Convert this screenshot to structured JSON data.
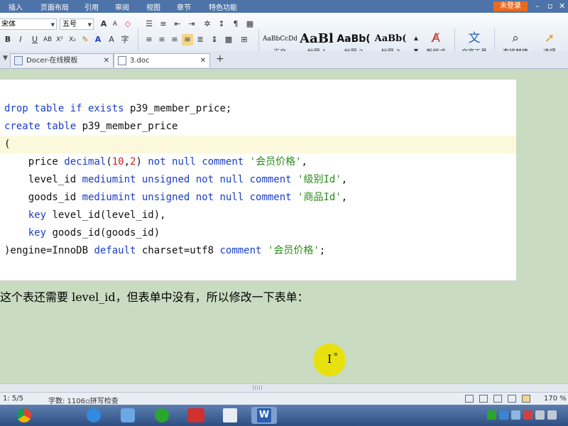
{
  "menubar": {
    "items": [
      "插入",
      "页面布局",
      "引用",
      "审阅",
      "视图",
      "章节",
      "特色功能"
    ],
    "login": "未登录"
  },
  "ribbon": {
    "font_name": "宋体",
    "font_size": "五号",
    "styles": [
      {
        "sample": "AaBbCcDd",
        "name": "正文"
      },
      {
        "sample": "AaBl",
        "name": "标题 1"
      },
      {
        "sample": "AaBb(",
        "name": "标题 2"
      },
      {
        "sample": "AaBb(",
        "name": "标题 3"
      }
    ],
    "new_style": "新样式",
    "text_tools": "文字工具",
    "find_replace": "查找替换",
    "select": "选择"
  },
  "tabs": [
    {
      "label": "Docer-在线模板"
    },
    {
      "label": "3.doc"
    }
  ],
  "code": {
    "line1": {
      "kw1": "drop table if exists",
      "rest": " p39_member_price;"
    },
    "line2": {
      "kw1": "create table",
      "rest": " p39_member_price"
    },
    "line3": "(",
    "line4": {
      "pre": "    price ",
      "kw1": "decimal",
      "p1": "(",
      "n1": "10",
      "p2": ",",
      "n2": "2",
      "p3": ") ",
      "kw2": "not null comment",
      "sp": " ",
      "str": "'会员价格'",
      "end": ","
    },
    "line5": {
      "pre": "    level_id ",
      "kw1": "mediumint unsigned not null comment",
      "sp": " ",
      "str": "'级别Id'",
      "end": ","
    },
    "line6": {
      "pre": "    goods_id ",
      "kw1": "mediumint unsigned not null comment",
      "sp": " ",
      "str": "'商品Id'",
      "end": ","
    },
    "line7": {
      "pre": "    ",
      "kw1": "key",
      "rest": " level_id(level_id),"
    },
    "line8": {
      "pre": "    ",
      "kw1": "key",
      "rest": " goods_id(goods_id)"
    },
    "line9": {
      "pre": ")engine=InnoDB ",
      "kw1": "default",
      "mid": " charset=utf8 ",
      "kw2": "comment",
      "sp": " ",
      "str": "'会员价格'",
      "end": ";"
    }
  },
  "prose": "这个表还需要 level_id，但表单中没有，所以修改一下表单：",
  "status": {
    "pos": "1: 5/5",
    "word_count": "字数: 1106",
    "spell": "拼写检查",
    "zoom": "170 %"
  },
  "colors": {
    "keyword": "#1b3fc4",
    "string": "#2a8a17",
    "number": "#d02020",
    "page_bg": "#c9dcc1"
  }
}
